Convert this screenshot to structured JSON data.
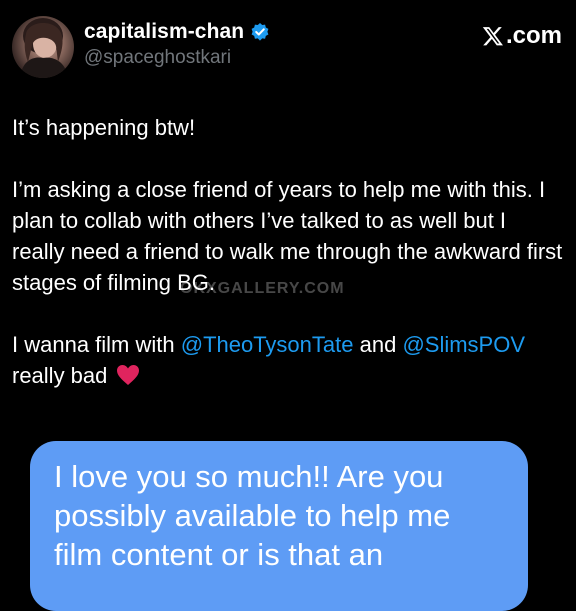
{
  "header": {
    "display_name": "capitalism-chan",
    "handle": "@spaceghostkari",
    "brand": ".com"
  },
  "tweet": {
    "line1": "It’s happening btw!",
    "para2": "I’m asking a close friend of years to help me with this. I plan to collab with others I’ve talked to as well but I really need a friend to walk me through the awkward first stages of filming BG.",
    "para3_start": "I wanna film with ",
    "mention1": "@TheoTysonTate",
    "para3_mid": " and ",
    "mention2": "@SlimsPOV",
    "para3_end": " really bad"
  },
  "watermark": "OKXGALLERY.COM",
  "message_bubble": {
    "text": "I love you so much!! Are you possibly available to help me film content or is that an"
  },
  "colors": {
    "background": "#000000",
    "mention": "#1d9bf0",
    "verified": "#1d9bf0",
    "bubble": "#5e9cf5",
    "heart": "#e0245e"
  }
}
